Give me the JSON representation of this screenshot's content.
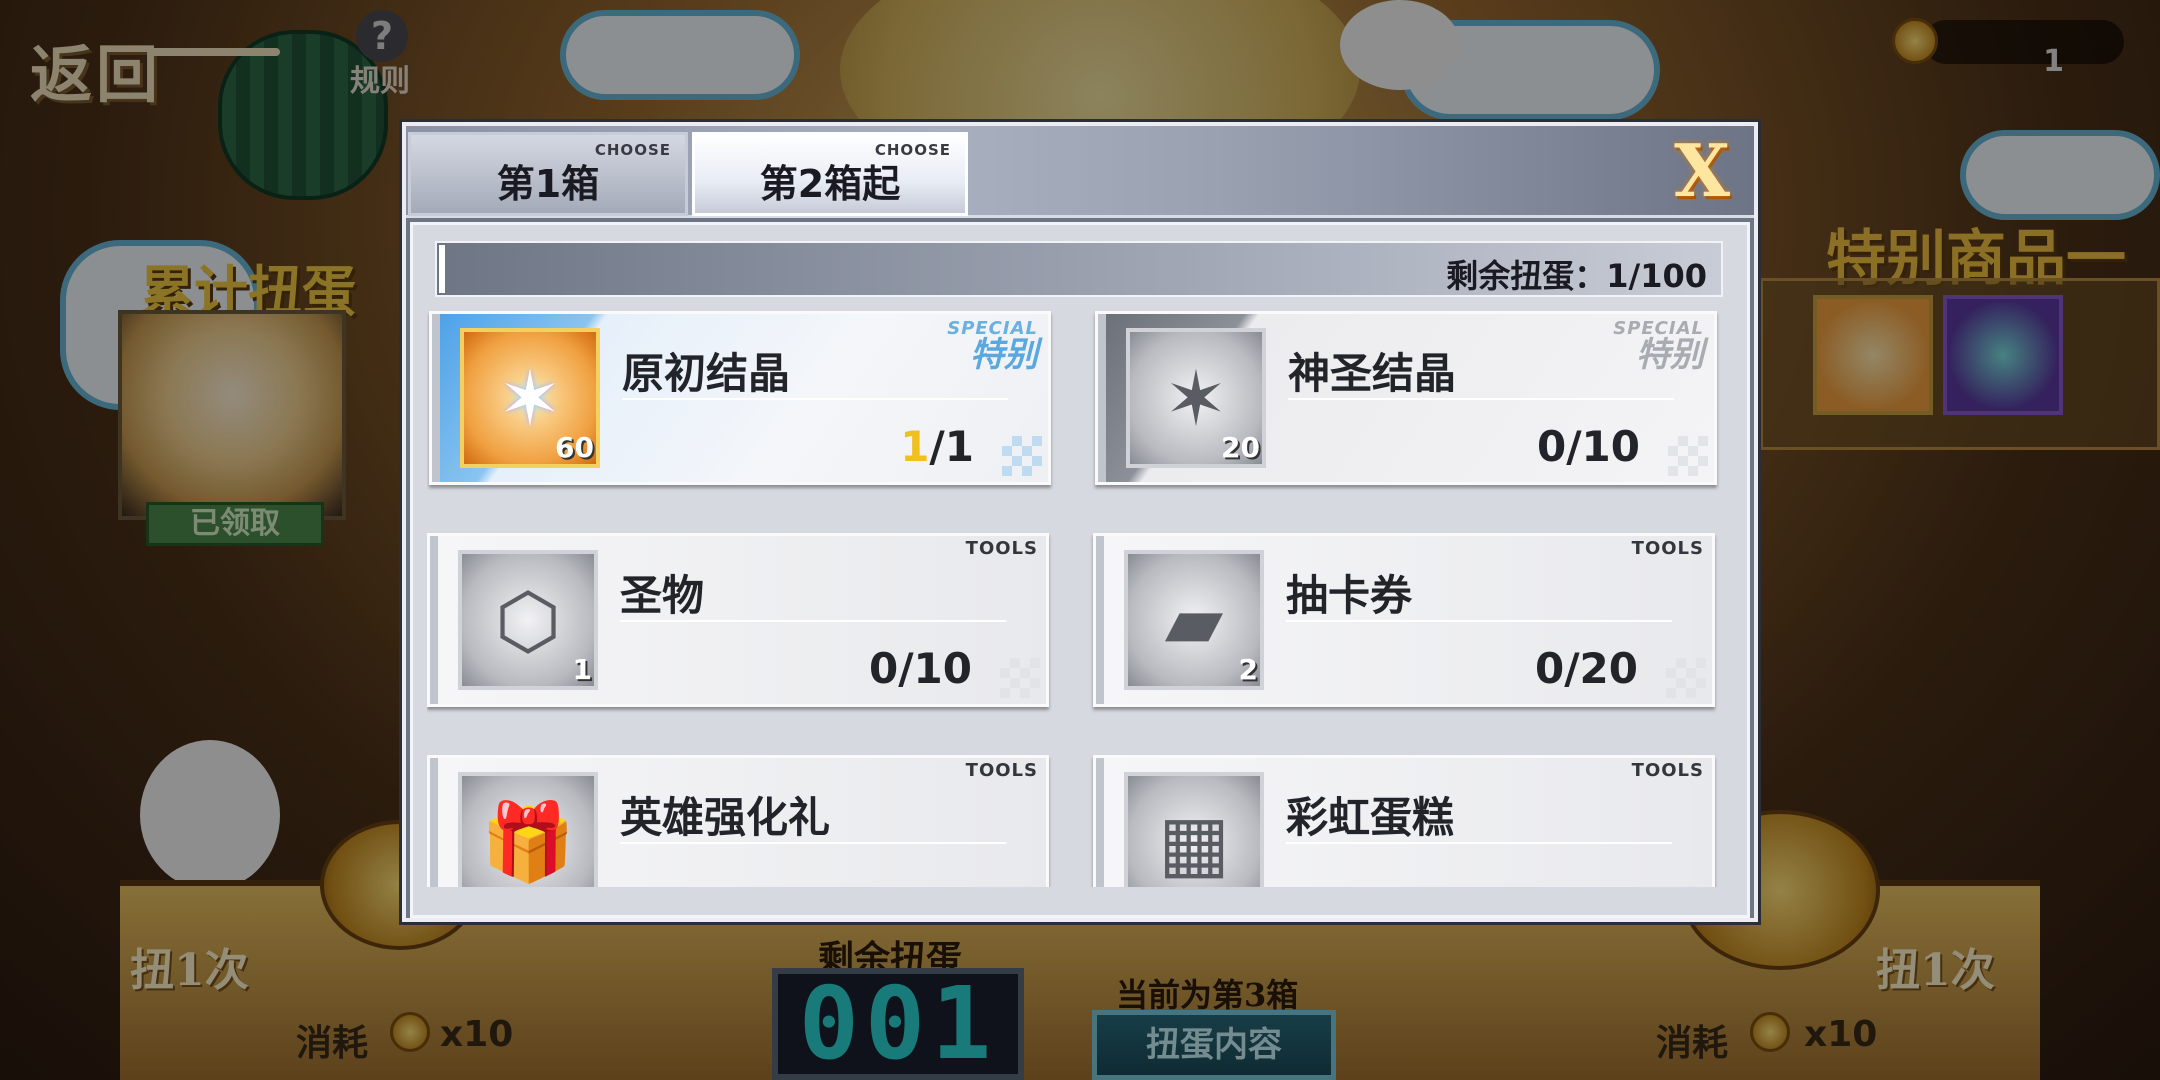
{
  "background": {
    "back_label": "返回",
    "rules_icon": "?",
    "rules_label": "规则",
    "currency_icon": "gold-coin-icon",
    "currency_value": "1",
    "cumulative_title": "累计扭蛋奖励",
    "claimed_label": "已领取",
    "special_goods_title": "特别商品一览",
    "pull_left": "扭1次",
    "pull_right": "扭1次",
    "cost_prefix": "消耗",
    "cost_amount": "x10",
    "remaining_label": "剩余扭蛋",
    "remaining_counter": "001",
    "current_box_text": "当前为第3箱",
    "content_button": "扭蛋内容"
  },
  "modal": {
    "tabs": [
      {
        "label": "第1箱",
        "tag": "CHOOSE",
        "active": false
      },
      {
        "label": "第2箱起",
        "tag": "CHOOSE",
        "active": true
      }
    ],
    "close_label": "X",
    "remaining_text": "剩余扭蛋：1/100",
    "items": [
      {
        "name": "原初结晶",
        "icon": "primal-crystal-icon",
        "glyph": "✶",
        "qty": "60",
        "owned": "1",
        "total": "/1",
        "badge_en": "SPECIAL",
        "badge_zh": "特别"
      },
      {
        "name": "神圣结晶",
        "icon": "holy-crystal-icon",
        "glyph": "✶",
        "qty": "20",
        "owned": "0/10",
        "badge_en": "SPECIAL",
        "badge_zh": "特别"
      },
      {
        "name": "圣物",
        "icon": "relic-hexagon-icon",
        "glyph": "⬡",
        "qty": "1",
        "owned": "0/10",
        "badge": "TOOLS"
      },
      {
        "name": "抽卡券",
        "icon": "draw-ticket-icon",
        "glyph": "▰",
        "qty": "2",
        "owned": "0/20",
        "badge": "TOOLS"
      },
      {
        "name": "英雄强化礼",
        "icon": "hero-gift-box-icon",
        "glyph": "🎁",
        "qty": "",
        "owned": "",
        "badge": "TOOLS"
      },
      {
        "name": "彩虹蛋糕",
        "icon": "rainbow-cake-icon",
        "glyph": "▦",
        "qty": "",
        "owned": "",
        "badge": "TOOLS"
      }
    ]
  }
}
